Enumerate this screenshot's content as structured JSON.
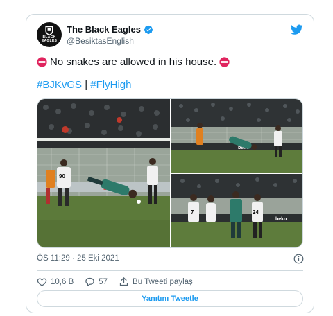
{
  "account": {
    "display_name": "The Black Eagles",
    "handle": "@BesiktasEnglish",
    "avatar_logo_text": "BLACK EAGLES"
  },
  "tweet": {
    "text": "No snakes are allowed in his house.",
    "hashtag_1": "#BJKvGS",
    "separator": "|",
    "hashtag_2": "#FlyHigh",
    "timestamp": "ÖS 11:29 · 25 Eki 2021"
  },
  "media": {
    "photos": [
      "goalkeeper-dive-save",
      "goalkeeper-save-closeup",
      "players-celebrating"
    ],
    "ad_text": "beko",
    "jersey_numbers": [
      "90",
      "7",
      "24"
    ]
  },
  "actions": {
    "likes": "10,6 B",
    "replies": "57",
    "share_label": "Bu Tweeti paylaş"
  },
  "reply_button": {
    "label": "Yanıtını Tweetle"
  },
  "colors": {
    "accent": "#1d9bf0",
    "secondary_text": "#536471",
    "border": "#cfd9de",
    "no_entry": "#e0245e"
  },
  "icons": [
    "verified-badge-icon",
    "twitter-bird-icon",
    "no-entry-icon",
    "info-icon",
    "heart-icon",
    "reply-icon",
    "share-icon"
  ]
}
